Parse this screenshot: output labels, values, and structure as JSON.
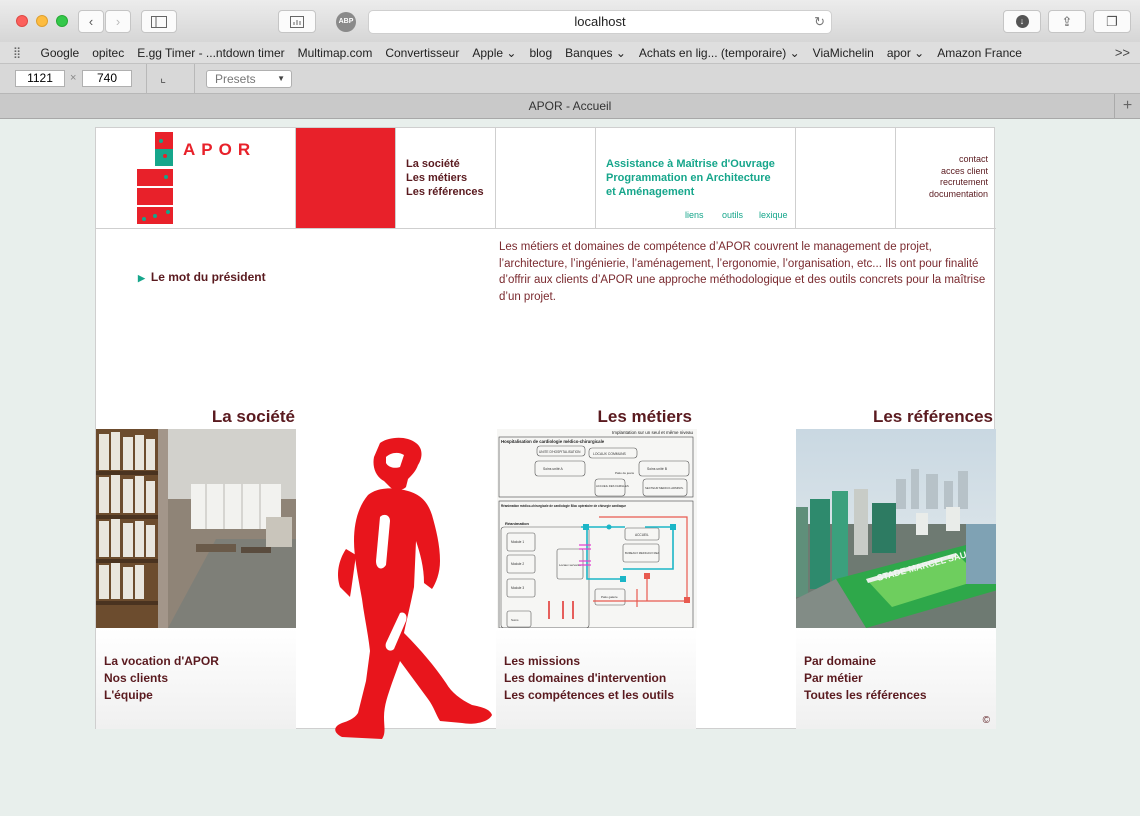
{
  "browser": {
    "url": "localhost",
    "abp": "ABP",
    "tab_title": "APOR - Accueil",
    "bookmarks": [
      "Google",
      "opitec",
      "E.gg Timer - ...ntdown timer",
      "Multimap.com",
      "Convertisseur",
      "Apple ⌄",
      "blog",
      "Banques ⌄",
      "Achats en lig... (temporaire) ⌄",
      "ViaMichelin",
      "apor ⌄",
      "Amazon France"
    ],
    "bookmarks_more": ">>",
    "width": "1121",
    "height": "740",
    "times": "×",
    "presets": "Presets"
  },
  "header": {
    "brand": "APOR",
    "nav": [
      "La société",
      "Les métiers",
      "Les références"
    ],
    "tagline": [
      "Assistance à Maîtrise d'Ouvrage",
      "Programmation en Architecture",
      "et Aménagement"
    ],
    "subnav": [
      "liens",
      "outils",
      "lexique"
    ],
    "rightnav": [
      "contact",
      "acces client",
      "recrutement",
      "documentation"
    ]
  },
  "president": "Le mot du président",
  "intro": "Les métiers et domaines de compétence d’APOR couvrent le management de projet, l’architecture, l’ingénierie, l’aménagement, l’ergonomie, l’organisation, etc... Ils ont pour finalité d’offrir aux clients d’APOR une approche méthodologique et des outils concrets pour la maîtrise d’un projet.",
  "sections": {
    "societe": {
      "title": "La société",
      "links": [
        "La vocation d'APOR",
        "Nos clients",
        "L'équipe"
      ]
    },
    "metiers": {
      "title": "Les métiers",
      "links": [
        "Les missions",
        "Les domaines d'intervention",
        "Les compétences et les outils"
      ],
      "plan_caption": "Implantation sur un seul et même niveau",
      "plan_title1": "Hospitalisation de cardiologie médico-chirurgicale",
      "plan_title2": "Réanimation médico-chirurgicale de cardiologie Bloc opératoire de chirurgie cardiaque",
      "plan_labels": [
        "UNITE D'HOSPITALISATION",
        "LOCAUX COMMUNS",
        "Soins unité A",
        "Patio de jeans",
        "Soins unité B",
        "ACCUEIL DES FAMILLES",
        "SECTEUR MEDICO-ADMINIS.",
        "Réanimation",
        "ACCUEIL",
        "BUREAUX MEDICAUX REA",
        "Module 1",
        "Module 2",
        "Module 3",
        "Locaux servants",
        "Patio galerie",
        "Soins"
      ]
    },
    "references": {
      "title": "Les références",
      "links": [
        "Par domaine",
        "Par métier",
        "Toutes les références"
      ],
      "stadium_text": "STADE MARCEL SAUPIN"
    }
  },
  "copyright": "©",
  "colors": {
    "brand_red": "#e8212a",
    "teal": "#16a68b",
    "maroon": "#5a1a1f"
  }
}
